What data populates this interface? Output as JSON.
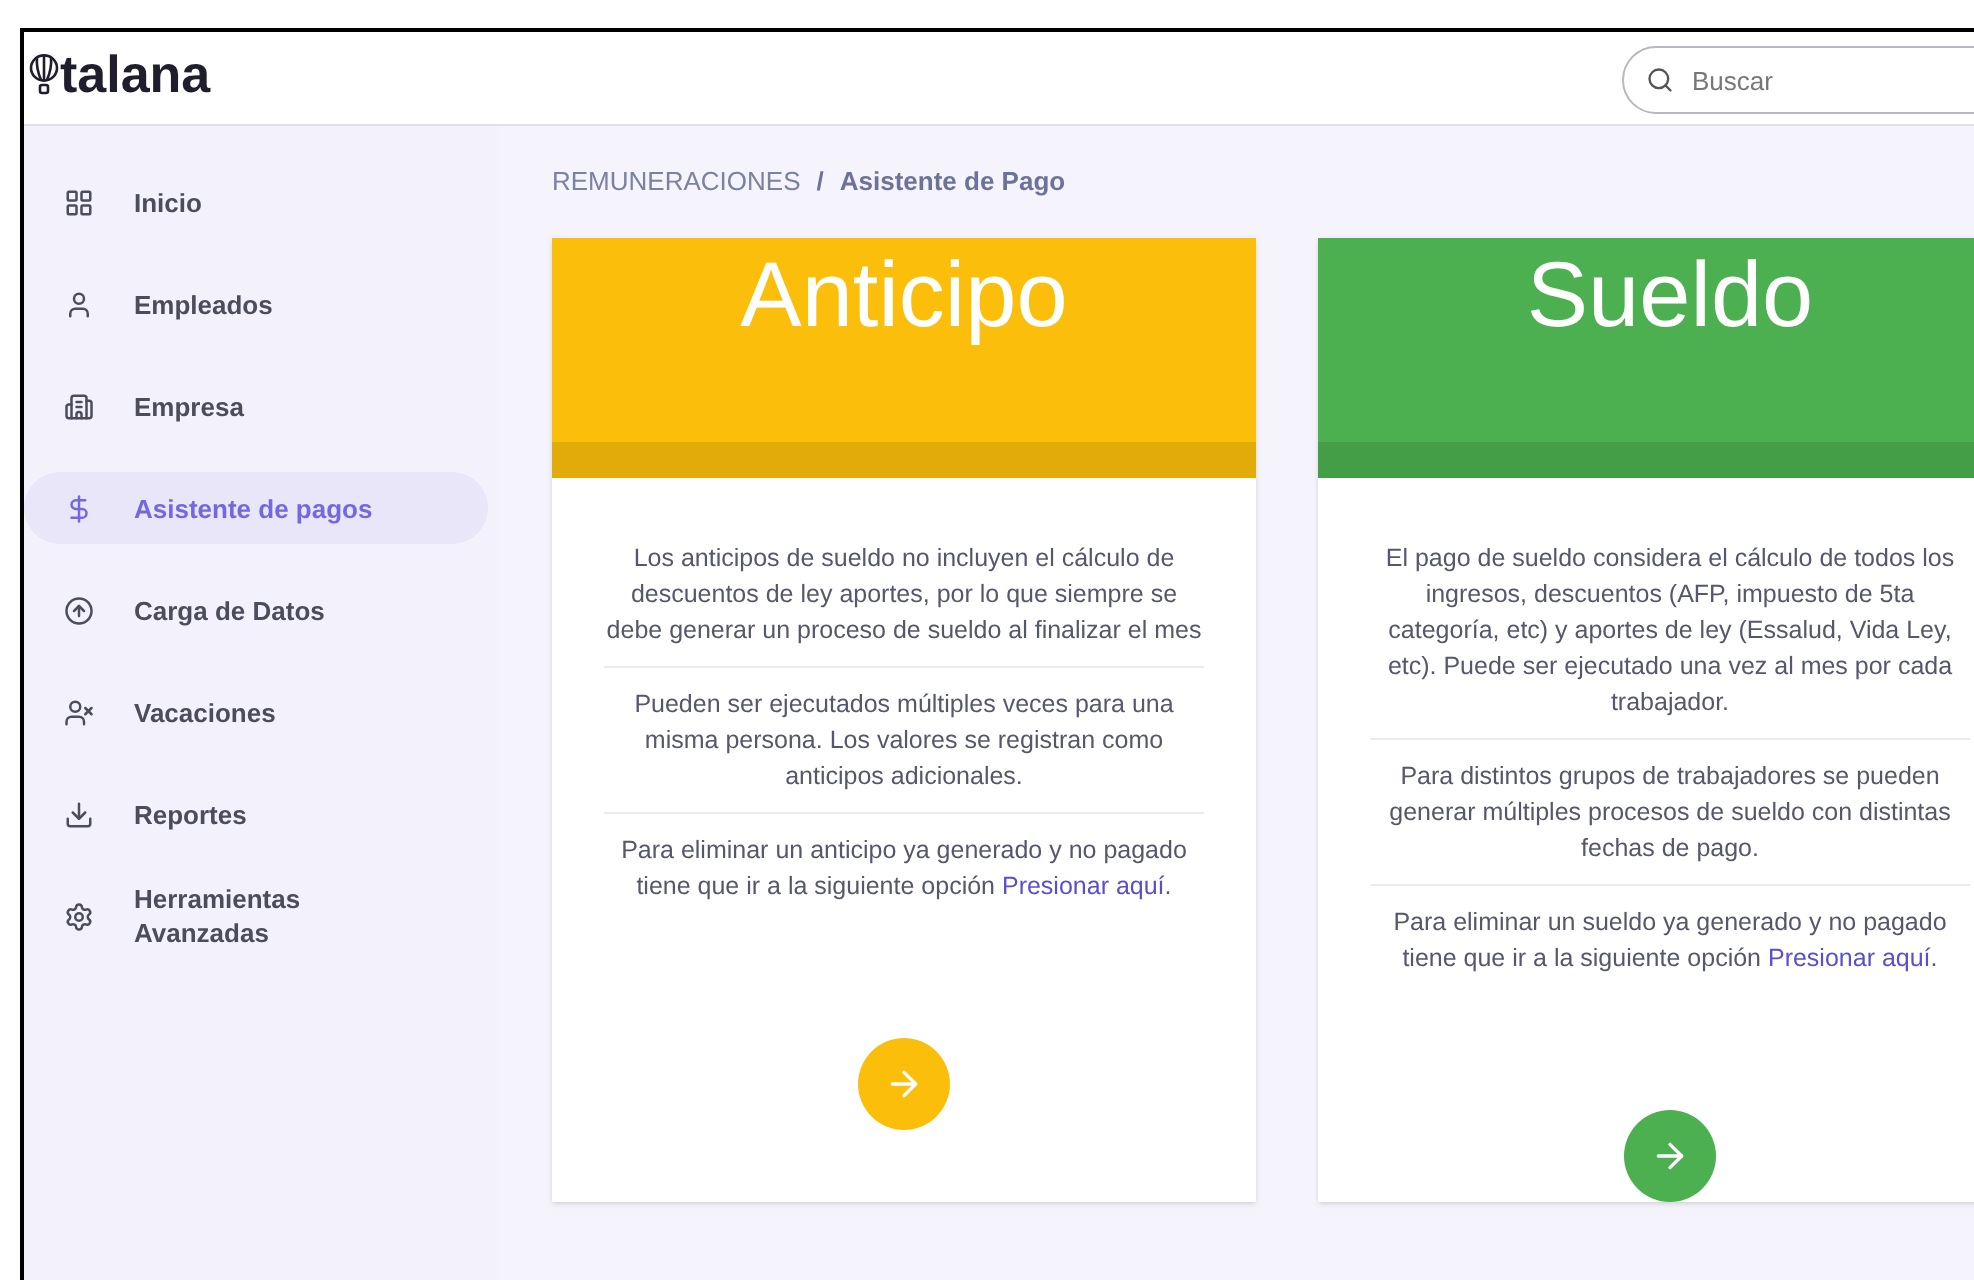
{
  "header": {
    "logo": "talana",
    "search": {
      "placeholder": "Buscar"
    }
  },
  "sidebar": {
    "items": [
      {
        "label": "Inicio",
        "selected": false
      },
      {
        "label": "Empleados",
        "selected": false
      },
      {
        "label": "Empresa",
        "selected": false
      },
      {
        "label": "Asistente de pagos",
        "selected": true
      },
      {
        "label": "Carga de Datos",
        "selected": false
      },
      {
        "label": "Vacaciones",
        "selected": false
      },
      {
        "label": "Reportes",
        "selected": false
      },
      {
        "label": "Herramientas Avanzadas",
        "selected": false
      }
    ]
  },
  "breadcrumb": {
    "section": "REMUNERACIONES",
    "separator": "/",
    "current": "Asistente de Pago"
  },
  "cards": [
    {
      "title": "Anticipo",
      "color": "#fbbf0b",
      "paragraphs": [
        "Los anticipos de sueldo no incluyen el cálculo de descuentos de ley aportes, por lo que siempre se debe generar un proceso de sueldo al finalizar el mes",
        "Pueden ser ejecutados múltiples veces para una misma persona. Los valores se registran como anticipos adicionales."
      ],
      "note": "Para eliminar un anticipo ya generado y no pagado tiene que ir a la siguiente opción",
      "link": "Presionar aquí",
      "link_after": "."
    },
    {
      "title": "Sueldo",
      "color": "#4caf50",
      "paragraphs": [
        "El pago de sueldo considera el cálculo de todos los ingresos, descuentos (AFP, impuesto de 5ta categoría, etc) y aportes de ley (Essalud, Vida Ley, etc). Puede ser ejecutado una vez al mes por cada trabajador.",
        "Para distintos grupos de trabajadores se pueden generar múltiples procesos de sueldo con distintas fechas de pago."
      ],
      "note": "Para eliminar un sueldo ya generado y no pagado tiene que ir a la siguiente opción",
      "link": "Presionar aquí",
      "link_after": "."
    }
  ]
}
